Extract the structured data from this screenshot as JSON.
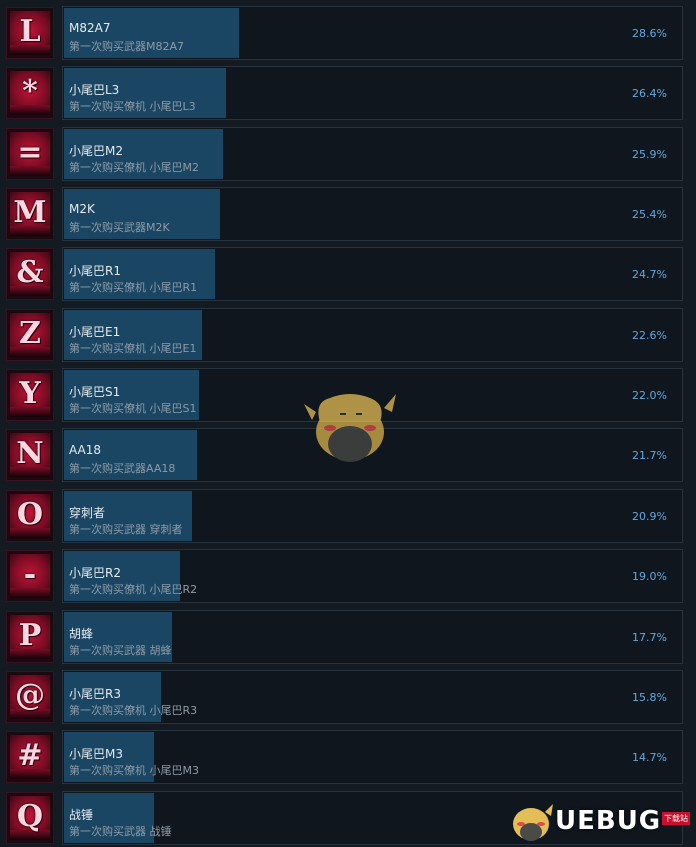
{
  "achievements": [
    {
      "name": "M82A7",
      "desc": "第一次购买武器M82A7",
      "percent": "28.6%",
      "value": 28.6,
      "glyph": "L"
    },
    {
      "name": "小尾巴L3",
      "desc": "第一次购买僚机 小尾巴L3",
      "percent": "26.4%",
      "value": 26.4,
      "glyph": "*"
    },
    {
      "name": "小尾巴M2",
      "desc": "第一次购买僚机 小尾巴M2",
      "percent": "25.9%",
      "value": 25.9,
      "glyph": "="
    },
    {
      "name": "M2K",
      "desc": "第一次购买武器M2K",
      "percent": "25.4%",
      "value": 25.4,
      "glyph": "M"
    },
    {
      "name": "小尾巴R1",
      "desc": "第一次购买僚机 小尾巴R1",
      "percent": "24.7%",
      "value": 24.7,
      "glyph": "&"
    },
    {
      "name": "小尾巴E1",
      "desc": "第一次购买僚机 小尾巴E1",
      "percent": "22.6%",
      "value": 22.6,
      "glyph": "Z"
    },
    {
      "name": "小尾巴S1",
      "desc": "第一次购买僚机 小尾巴S1",
      "percent": "22.0%",
      "value": 22.0,
      "glyph": "Y"
    },
    {
      "name": "AA18",
      "desc": "第一次购买武器AA18",
      "percent": "21.7%",
      "value": 21.7,
      "glyph": "N"
    },
    {
      "name": "穿刺者",
      "desc": "第一次购买武器 穿刺者",
      "percent": "20.9%",
      "value": 20.9,
      "glyph": "O"
    },
    {
      "name": "小尾巴R2",
      "desc": "第一次购买僚机 小尾巴R2",
      "percent": "19.0%",
      "value": 19.0,
      "glyph": "-"
    },
    {
      "name": "胡蜂",
      "desc": "第一次购买武器 胡蜂",
      "percent": "17.7%",
      "value": 17.7,
      "glyph": "P"
    },
    {
      "name": "小尾巴R3",
      "desc": "第一次购买僚机 小尾巴R3",
      "percent": "15.8%",
      "value": 15.8,
      "glyph": "@"
    },
    {
      "name": "小尾巴M3",
      "desc": "第一次购买僚机 小尾巴M3",
      "percent": "14.7%",
      "value": 14.7,
      "glyph": "#"
    },
    {
      "name": "战锤",
      "desc": "第一次购买武器 战锤",
      "percent": "",
      "value": 14.7,
      "glyph": "Q"
    }
  ],
  "watermark": {
    "logo_text": "UEBUG",
    "badge_text": "下载站"
  },
  "colors": {
    "bar_fill": "#1b4663",
    "percent_text": "#62a8e0",
    "icon_red": "#c21336"
  }
}
